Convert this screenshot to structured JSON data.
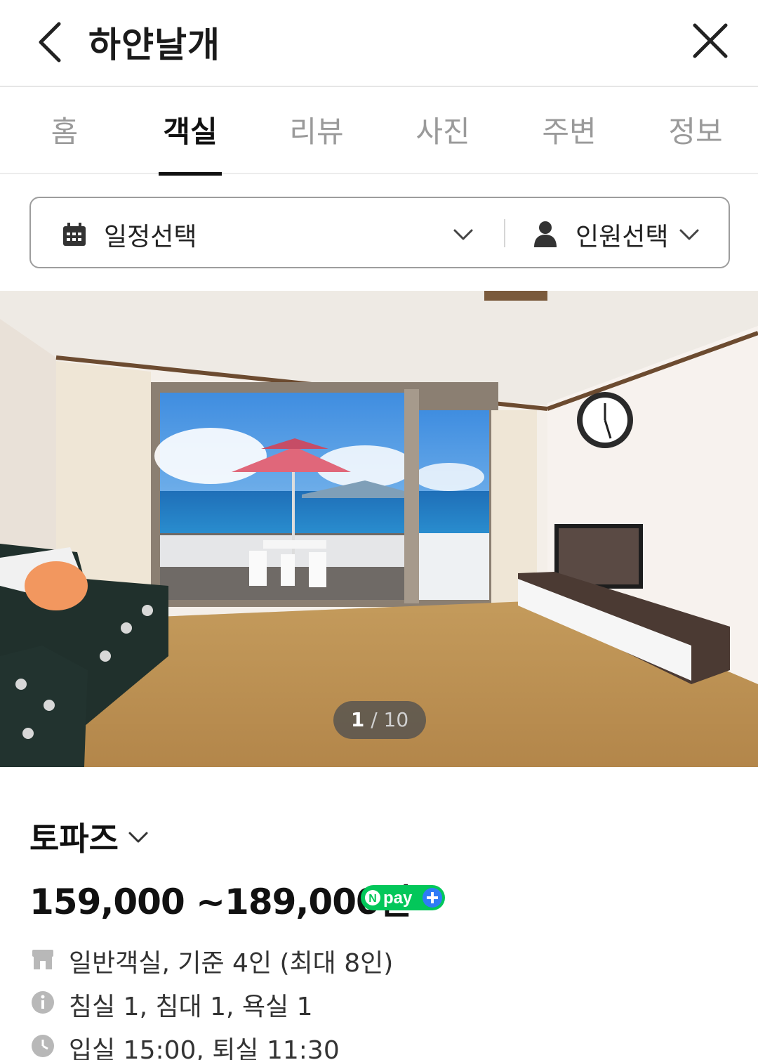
{
  "header": {
    "title": "하얀날개"
  },
  "tabs": [
    {
      "label": "홈",
      "active": false
    },
    {
      "label": "객실",
      "active": true
    },
    {
      "label": "리뷰",
      "active": false
    },
    {
      "label": "사진",
      "active": false
    },
    {
      "label": "주변",
      "active": false
    },
    {
      "label": "정보",
      "active": false
    }
  ],
  "selector": {
    "date_label": "일정선택",
    "people_label": "인원선택"
  },
  "gallery": {
    "current": "1",
    "separator": " / ",
    "total": "10"
  },
  "room": {
    "name": "토파즈",
    "price": "159,000 ~189,000원",
    "badge": "pay",
    "details": [
      {
        "icon": "room-type-icon",
        "text": "일반객실, 기준 4인 (최대 8인)"
      },
      {
        "icon": "info-icon",
        "text": "침실 1, 침대 1, 욕실 1"
      },
      {
        "icon": "clock-icon",
        "text": "입실 15:00, 퇴실 11:30"
      }
    ]
  },
  "colors": {
    "active_tab": "#111111",
    "inactive_tab": "#9a9a9a",
    "npay_green": "#03c75a",
    "npay_blue": "#2e7cf6"
  }
}
